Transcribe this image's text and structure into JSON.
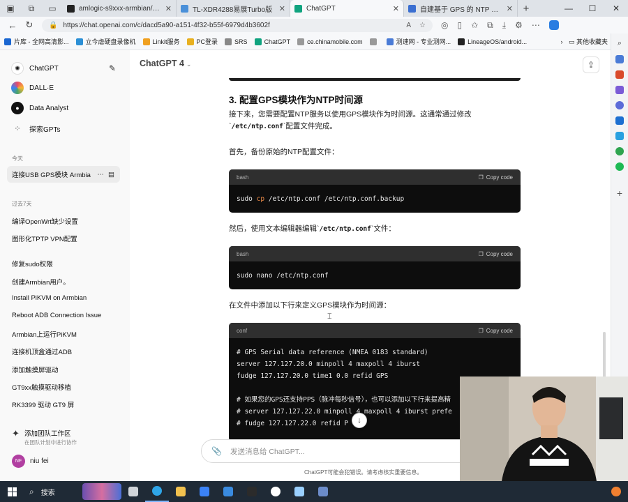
{
  "tabs": [
    {
      "title": "amlogic-s9xxx-armbian/READM",
      "color": "#222222",
      "active": false
    },
    {
      "title": "TL-XDR4288易展Turbo版",
      "color": "#4a90d9",
      "active": false
    },
    {
      "title": "ChatGPT",
      "color": "#10a37f",
      "active": true
    },
    {
      "title": "自建基于 GPS 的 NTP 服务器 -",
      "color": "#3b6fd1",
      "active": false
    }
  ],
  "address_bar": {
    "url": "https://chat.openai.com/c/dacd5a90-a151-4f32-b55f-6979d4b3602f"
  },
  "bookmarks": [
    {
      "label": "片库 - 全网高清影...",
      "color": "#1a66d1"
    },
    {
      "label": "立今虐硬盘录像机",
      "color": "#2b8fd6"
    },
    {
      "label": "Linkit服务",
      "color": "#f0a020"
    },
    {
      "label": "PC登录",
      "color": "#e8b020"
    },
    {
      "label": "SRS",
      "color": "#888888"
    },
    {
      "label": "ChatGPT",
      "color": "#10a37f"
    },
    {
      "label": "ce.chinamobile.com",
      "color": "#999999"
    },
    {
      "label": "",
      "color": "#999999"
    },
    {
      "label": "测速网 - 专业测网...",
      "color": "#4a7bd6"
    },
    {
      "label": "LineageOS/android...",
      "color": "#222222"
    }
  ],
  "bookmarks_more": "其他收藏夹",
  "gpt_sidebar": {
    "top": [
      {
        "label": "ChatGPT",
        "color": "#ffffff",
        "glyph": "✺"
      },
      {
        "label": "DALL·E",
        "color": "#4aa36b",
        "glyph": ""
      },
      {
        "label": "Data Analyst",
        "color": "#111111",
        "glyph": "●"
      },
      {
        "label": "探索GPTs",
        "color": "#f9f9f9",
        "glyph": "⁘"
      }
    ],
    "section_today": "今天",
    "active_chat": "连接USB GPS模块 Armbia",
    "section_7days": "过去7天",
    "history": [
      "编译OpenWrt缺少设置",
      "图形化TPTP VPN配置",
      "修复sudo权限",
      "创建Armbian用户。",
      "Install PiKVM on Armbian",
      "Reboot ADB Connection Issue",
      "Armbian上运行PiKVM",
      "连接机顶盒通过ADB",
      "添加触摸屏驱动",
      "GT9xx触摸驱动移植",
      "RK3399 驱动 GT9 屏"
    ],
    "team_title": "添加团队工作区",
    "team_sub": "在团队计划中进行协作",
    "user_initials": "NF",
    "user_name": "niu fei"
  },
  "main": {
    "model_name": "ChatGPT 4",
    "heading": "3. 配置GPS模块作为NTP时间源",
    "para1_line1": "接下来，您需要配置NTP服务以使用GPS模块作为时间源。这通常通过修改",
    "para1_code": "/etc/ntp.conf",
    "para1_tail": "配置文件完成。",
    "para2": "首先，备份原始的NTP配置文件：",
    "para3_head": "然后，使用文本编辑器编辑",
    "para3_code": "/etc/ntp.conf",
    "para3_tail": "文件：",
    "para4": "在文件中添加以下行来定义GPS模块作为时间源：",
    "copy_label": "Copy code",
    "code1": {
      "lang": "bash",
      "pre": "sudo ",
      "kw": "cp",
      "post": " /etc/ntp.conf /etc/ntp.conf.backup"
    },
    "code2": {
      "lang": "bash",
      "text": "sudo nano /etc/ntp.conf"
    },
    "code3": {
      "lang": "conf",
      "lines": [
        "# GPS Serial data reference (NMEA 0183 standard)",
        "server 127.127.20.0 minpoll 4 maxpoll 4 iburst",
        "fudge 127.127.20.0 time1 0.0 refid GPS",
        "",
        "# 如果您的GPS还支持PPS（脉冲每秒信号），也可以添加以下行来提高精",
        "# server 127.127.22.0 minpoll 4 maxpoll 4 iburst prefe",
        "# fudge 127.127.22.0 refid P"
      ]
    },
    "composer_placeholder": "发送消息给 ChatGPT...",
    "disclaimer": "ChatGPT可能会犯错误。请考虑核实重要信息。"
  },
  "taskbar": {
    "search_label": "搜索",
    "apps": [
      {
        "name": "task-view",
        "color": "#d0d4d9"
      },
      {
        "name": "edge",
        "color": "#2fa5e8"
      },
      {
        "name": "file-explorer",
        "color": "#f2c14e"
      },
      {
        "name": "store",
        "color": "#3b82f6"
      },
      {
        "name": "mail",
        "color": "#3a8be0"
      },
      {
        "name": "terminal",
        "color": "#2b2b2b"
      },
      {
        "name": "chatgpt",
        "color": "#ffffff"
      },
      {
        "name": "tool",
        "color": "#9ad0ff"
      },
      {
        "name": "app",
        "color": "#6c8cc9"
      }
    ]
  }
}
